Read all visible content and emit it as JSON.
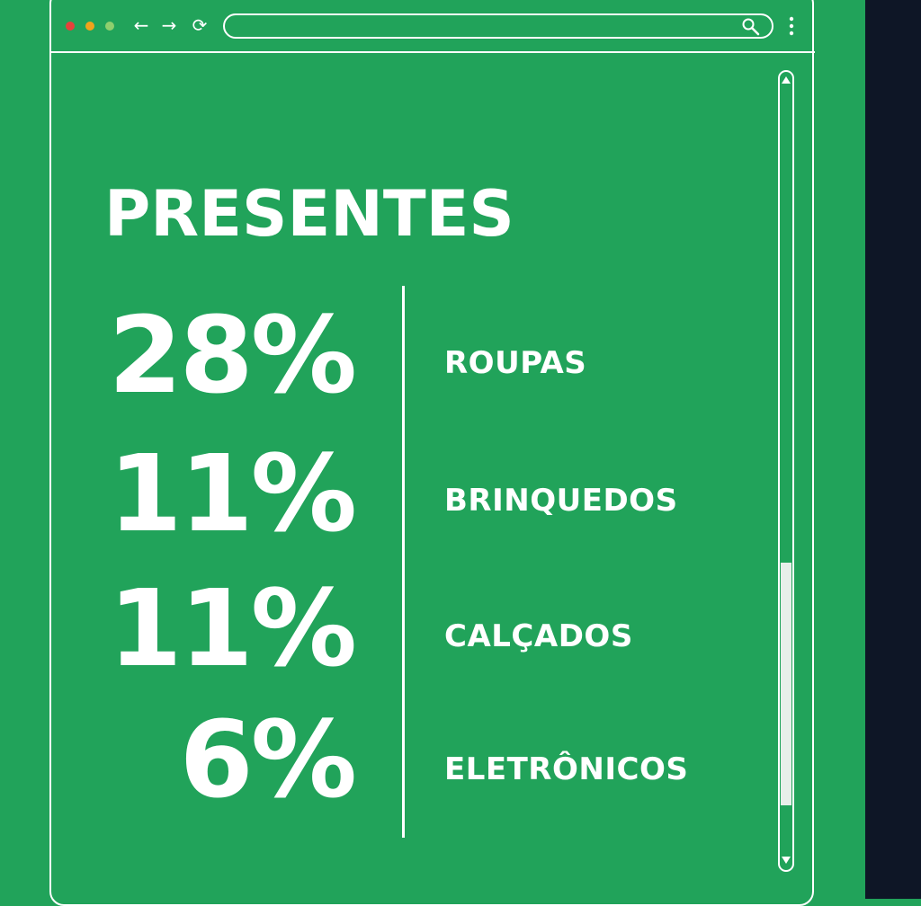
{
  "window": {
    "controls": [
      {
        "name": "close",
        "color": "#e5413b"
      },
      {
        "name": "minimize",
        "color": "#f2a31c"
      },
      {
        "name": "maximize",
        "color": "#8fcf6e"
      }
    ],
    "nav": {
      "back_icon": "←",
      "forward_icon": "→",
      "reload_icon": "⟳"
    },
    "address_bar": {
      "value": "",
      "icon": "search-icon"
    },
    "menu_icon": "kebab-menu-icon"
  },
  "content": {
    "title": "PRESENTES",
    "stats": [
      {
        "value": "28%",
        "label": "ROUPAS"
      },
      {
        "value": "11%",
        "label": "BRINQUEDOS"
      },
      {
        "value": "11%",
        "label": "CALÇADOS"
      },
      {
        "value": "6%",
        "label": "ELETRÔNICOS"
      }
    ]
  },
  "colors": {
    "background": "#21a35a",
    "text": "#ffffff",
    "side_panel": "#0e1626",
    "scroll_thumb": "#e8efe9"
  }
}
